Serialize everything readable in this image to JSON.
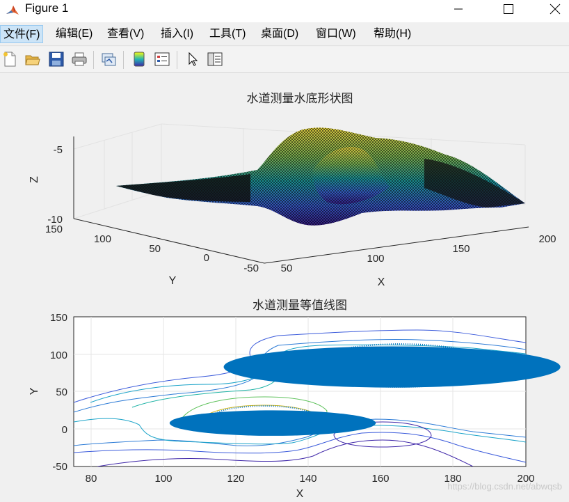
{
  "window": {
    "title": "Figure 1",
    "minimize_glyph": "—",
    "maximize_glyph": "☐",
    "close_glyph": "✕"
  },
  "menubar": {
    "items": [
      {
        "label": "文件(F)"
      },
      {
        "label": "编辑(E)"
      },
      {
        "label": "查看(V)"
      },
      {
        "label": "插入(I)"
      },
      {
        "label": "工具(T)"
      },
      {
        "label": "桌面(D)"
      },
      {
        "label": "窗口(W)"
      },
      {
        "label": "帮助(H)"
      }
    ]
  },
  "toolbar": {
    "icons": [
      "new-figure-icon",
      "open-file-icon",
      "save-icon",
      "print-icon",
      "link-plot-icon",
      "insert-colorbar-icon",
      "insert-legend-icon",
      "pointer-icon",
      "property-inspector-icon"
    ]
  },
  "chart_data": [
    {
      "type": "surface",
      "title": "水道测量水底形状图",
      "xlabel": "X",
      "ylabel": "Y",
      "zlabel": "Z",
      "x_ticks": [
        "50",
        "100",
        "150",
        "200"
      ],
      "y_ticks": [
        "-50",
        "0",
        "50",
        "100",
        "150"
      ],
      "z_ticks": [
        "-5",
        "-10"
      ],
      "xlim": [
        50,
        200
      ],
      "ylim": [
        -50,
        150
      ],
      "zlim": [
        -10,
        -5
      ],
      "colormap": "parula",
      "grid": true
    },
    {
      "type": "contour",
      "title": "水道测量等值线图",
      "xlabel": "X",
      "ylabel": "Y",
      "x_ticks": [
        "80",
        "100",
        "120",
        "140",
        "160",
        "180",
        "200"
      ],
      "y_ticks": [
        "150",
        "100",
        "50",
        "0",
        "-50"
      ],
      "xlim": [
        75,
        200
      ],
      "ylim": [
        -50,
        150
      ],
      "grid": true,
      "filled_regions": [
        {
          "center_x": 130,
          "center_y": 8,
          "width": 30,
          "height": 34,
          "color": "#0072bd"
        },
        {
          "center_x": 163,
          "center_y": 83,
          "width": 49,
          "height": 55,
          "color": "#0072bd"
        }
      ]
    }
  ],
  "watermark": "https://blog.csdn.net/abwqsb"
}
